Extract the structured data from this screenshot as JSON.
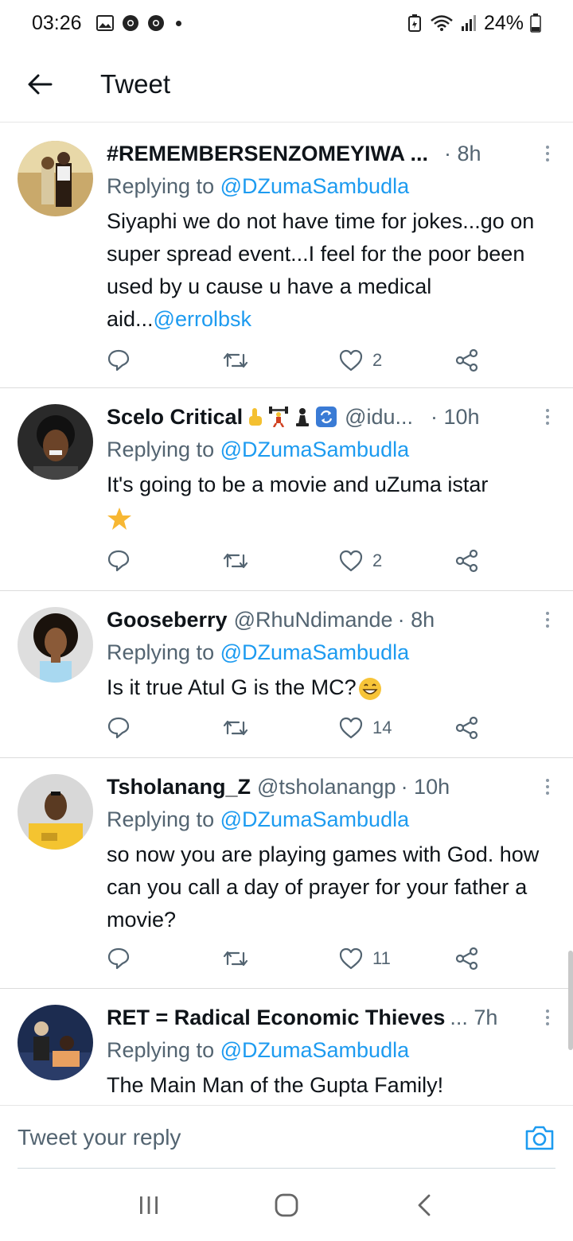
{
  "status_bar": {
    "time": "03:26",
    "battery": "24%"
  },
  "header": {
    "title": "Tweet"
  },
  "tweets": [
    {
      "name": "#REMEMBERSENZOMEYIWA ...",
      "handle": "",
      "time": "· 8h",
      "replying_prefix": "Replying to ",
      "replying_to": "@DZumaSambudla",
      "text": "Siyaphi we do not have time for jokes...go on super spread event...I feel for the poor been used by u cause u have a  medical aid...",
      "text_mention": "@errolbsk",
      "likes": "2"
    },
    {
      "name": "Scelo Critical",
      "handle": "@idu...",
      "time": "· 10h",
      "replying_prefix": "Replying to ",
      "replying_to": "@DZumaSambudla",
      "text": "It's going to be a movie and uZuma istar",
      "likes": "2"
    },
    {
      "name": "Gooseberry",
      "handle": "@RhuNdimande",
      "time": "· 8h",
      "replying_prefix": "Replying to ",
      "replying_to": "@DZumaSambudla",
      "text": "Is it true Atul G is the MC?",
      "likes": "14"
    },
    {
      "name": "Tsholanang_Z",
      "handle": "@tsholanangp",
      "time": "· 10h",
      "replying_prefix": "Replying to ",
      "replying_to": "@DZumaSambudla",
      "text": "so now you are playing games with God. how can you call a day of prayer for your father a movie?",
      "likes": "11"
    },
    {
      "name": "RET = Radical Economic Thieves",
      "handle": "",
      "time": "... 7h",
      "replying_prefix": "Replying to ",
      "replying_to": "@DZumaSambudla",
      "text": "The Main Man of the Gupta Family!"
    }
  ],
  "reply_box": {
    "placeholder": "Tweet your reply"
  },
  "colors": {
    "accent": "#1d9bf0",
    "secondary_text": "#536471",
    "primary_text": "#0f1419"
  }
}
